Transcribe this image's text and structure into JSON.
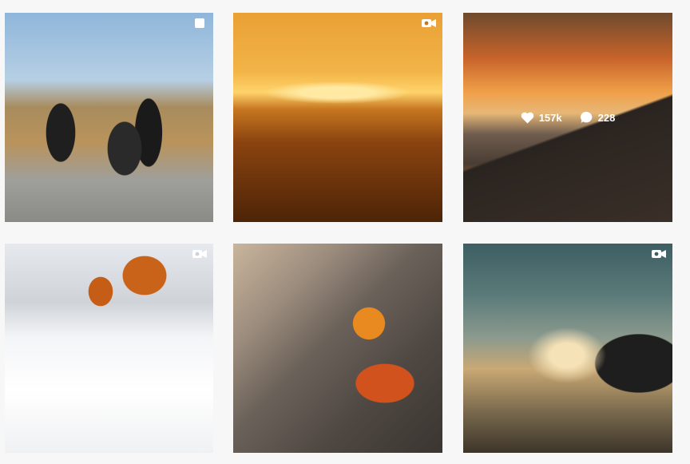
{
  "grid": {
    "posts": [
      {
        "id": "post-1",
        "type_icon": "multi-photo-icon"
      },
      {
        "id": "post-2",
        "type_icon": "video-camera-icon"
      },
      {
        "id": "post-3",
        "type_icon": "",
        "hover": {
          "likes": "157k",
          "comments": "228",
          "like_icon": "heart-icon",
          "comment_icon": "comment-bubble-icon"
        }
      },
      {
        "id": "post-4",
        "type_icon": "video-camera-icon"
      },
      {
        "id": "post-5",
        "type_icon": ""
      },
      {
        "id": "post-6",
        "type_icon": "video-camera-icon"
      }
    ]
  },
  "colors": {
    "background": "#f7f7f7",
    "overlay_text": "#ffffff"
  }
}
